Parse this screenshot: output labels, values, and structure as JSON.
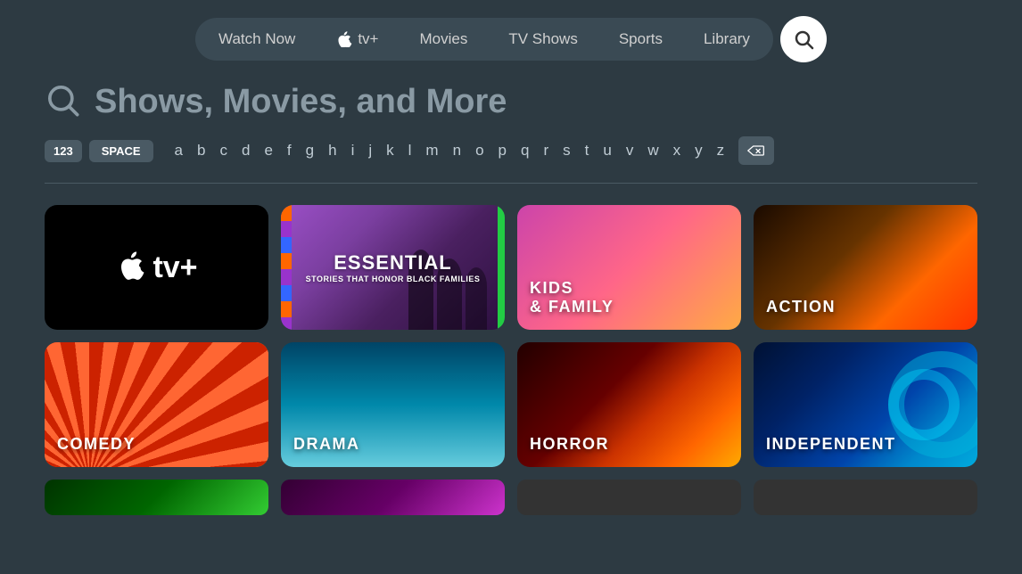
{
  "nav": {
    "items": [
      {
        "label": "Watch Now",
        "id": "watch-now"
      },
      {
        "label": "Apple TV+",
        "id": "appletv-plus"
      },
      {
        "label": "Movies",
        "id": "movies"
      },
      {
        "label": "TV Shows",
        "id": "tv-shows"
      },
      {
        "label": "Sports",
        "id": "sports"
      },
      {
        "label": "Library",
        "id": "library"
      }
    ]
  },
  "search": {
    "heading": "Shows, Movies, and More"
  },
  "keyboard": {
    "special_keys": [
      "123",
      "SPACE"
    ],
    "letters": [
      "a",
      "b",
      "c",
      "d",
      "e",
      "f",
      "g",
      "h",
      "i",
      "j",
      "k",
      "l",
      "m",
      "n",
      "o",
      "p",
      "q",
      "r",
      "s",
      "t",
      "u",
      "v",
      "w",
      "x",
      "y",
      "z"
    ]
  },
  "categories": [
    {
      "id": "appletv",
      "label": "Apple TV+",
      "type": "appletv"
    },
    {
      "id": "essential",
      "label": "ESSENTIAL",
      "sublabel": "STORIES THAT HONOR BLACK FAMILIES",
      "type": "essential"
    },
    {
      "id": "kids",
      "label": "KIDS\n& FAMILY",
      "type": "kids"
    },
    {
      "id": "action",
      "label": "ACTION",
      "type": "action"
    },
    {
      "id": "comedy",
      "label": "COMEDY",
      "type": "comedy"
    },
    {
      "id": "drama",
      "label": "DRAMA",
      "type": "drama"
    },
    {
      "id": "horror",
      "label": "HORROR",
      "type": "horror"
    },
    {
      "id": "independent",
      "label": "INDEPENDENT",
      "type": "independent"
    }
  ]
}
